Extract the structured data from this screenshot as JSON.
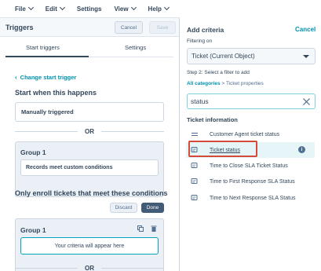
{
  "menubar": {
    "items": [
      {
        "label": "File",
        "has_chevron": true
      },
      {
        "label": "Edit",
        "has_chevron": true
      },
      {
        "label": "Settings",
        "has_chevron": false
      },
      {
        "label": "View",
        "has_chevron": true
      },
      {
        "label": "Help",
        "has_chevron": true
      }
    ]
  },
  "left_panel": {
    "title": "Triggers",
    "cancel_label": "Cancel",
    "save_label": "Save",
    "tabs": [
      {
        "label": "Start triggers",
        "active": true
      },
      {
        "label": "Settings",
        "active": false
      }
    ],
    "back_link": "Change start trigger",
    "start_heading": "Start when this happens",
    "trigger_value": "Manually triggered",
    "or_label": "OR",
    "group1": {
      "title": "Group 1",
      "condition": "Records meet custom conditions"
    },
    "enroll_heading": "Only enroll tickets that meet these conditions",
    "discard_label": "Discard",
    "done_label": "Done",
    "group2": {
      "title": "Group 1",
      "placeholder": "Your criteria will appear here"
    },
    "or_label_2": "OR"
  },
  "right_panel": {
    "title": "Add criteria",
    "cancel_label": "Cancel",
    "filtering_label": "Filtering on",
    "object_select": "Ticket (Current Object)",
    "step_label": "Step 2: Select a filter to add",
    "crumb_link": "All categories",
    "crumb_sep": ">",
    "crumb_current": "Ticket properties",
    "search_value": "status",
    "group_heading": "Ticket information",
    "items": [
      {
        "label": "Customer Agent ticket status",
        "icon": "equals-icon"
      },
      {
        "label": "Ticket status",
        "icon": "enum-icon",
        "active": true
      },
      {
        "label": "Time to Close SLA Ticket Status",
        "icon": "enum-icon"
      },
      {
        "label": "Time to First Response SLA Status",
        "icon": "enum-icon"
      },
      {
        "label": "Time to Next Response SLA Status",
        "icon": "enum-icon"
      }
    ]
  },
  "colors": {
    "accent_link": "#0091ae",
    "highlight_border": "#d44b3a",
    "done_button": "#425b76"
  }
}
